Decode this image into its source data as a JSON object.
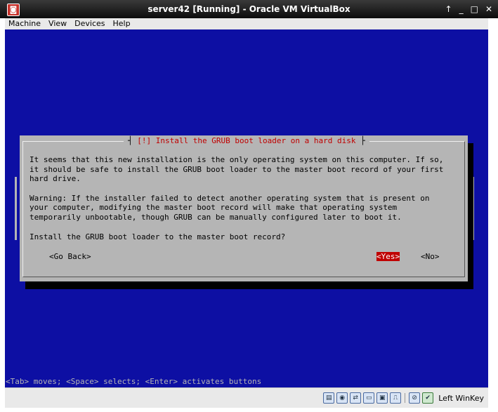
{
  "window": {
    "title": "server42 [Running] - Oracle VM VirtualBox",
    "controls": [
      "↑",
      "_",
      "□",
      "✕"
    ]
  },
  "menu": [
    "Machine",
    "View",
    "Devices",
    "Help"
  ],
  "dialog": {
    "title_open": "┤ ",
    "title": "[!] Install the GRUB boot loader on a hard disk",
    "title_close": " ├",
    "body": [
      "It seems that this new installation is the only operating system on this computer. If so,",
      "it should be safe to install the GRUB boot loader to the master boot record of your first",
      "hard drive.",
      "",
      "Warning: If the installer failed to detect another operating system that is present on",
      "your computer, modifying the master boot record will make that operating system",
      "temporarily unbootable, though GRUB can be manually configured later to boot it."
    ],
    "question": "Install the GRUB boot loader to the master boot record?",
    "buttons": {
      "back": "<Go Back>",
      "yes": "<Yes>",
      "no": "<No>"
    }
  },
  "help_line": "<Tab> moves; <Space> selects; <Enter> activates buttons",
  "statusbar": {
    "icons": [
      "harddisk-icon",
      "optical-drive-icon",
      "network-icon",
      "folder-icon",
      "display-icon",
      "usb-icon",
      "shared-clipboard-icon",
      "mouse-integration-icon"
    ],
    "host_key": "Left WinKey"
  },
  "colors": {
    "console_bg": "#0d0fa3",
    "dialog_bg": "#b5b5b5",
    "title_red": "#c00000",
    "selected_button": "#c00000"
  }
}
